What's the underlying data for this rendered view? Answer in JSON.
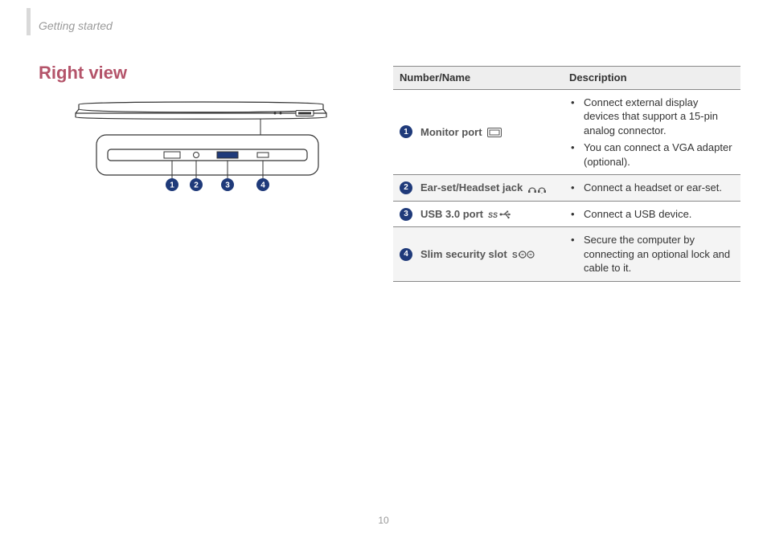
{
  "header": {
    "section": "Getting started"
  },
  "heading": "Right view",
  "page_number": "10",
  "diagram": {
    "callouts": [
      "1",
      "2",
      "3",
      "4"
    ]
  },
  "table": {
    "headers": {
      "num_name": "Number/Name",
      "description": "Description"
    },
    "rows": [
      {
        "num": "1",
        "name": "Monitor port",
        "icon": "monitor-port-icon",
        "descriptions": [
          "Connect external display devices that support a 15-pin analog connector.",
          "You can connect a VGA adapter (optional)."
        ]
      },
      {
        "num": "2",
        "name": "Ear-set/Headset jack",
        "icon": "headset-icon",
        "descriptions": [
          "Connect a headset or ear-set."
        ]
      },
      {
        "num": "3",
        "name": "USB 3.0 port",
        "icon": "usb-ss-icon",
        "descriptions": [
          "Connect a USB device."
        ]
      },
      {
        "num": "4",
        "name": "Slim security slot",
        "icon": "security-slot-icon",
        "descriptions": [
          "Secure the computer by connecting an optional lock and cable to it."
        ]
      }
    ]
  }
}
